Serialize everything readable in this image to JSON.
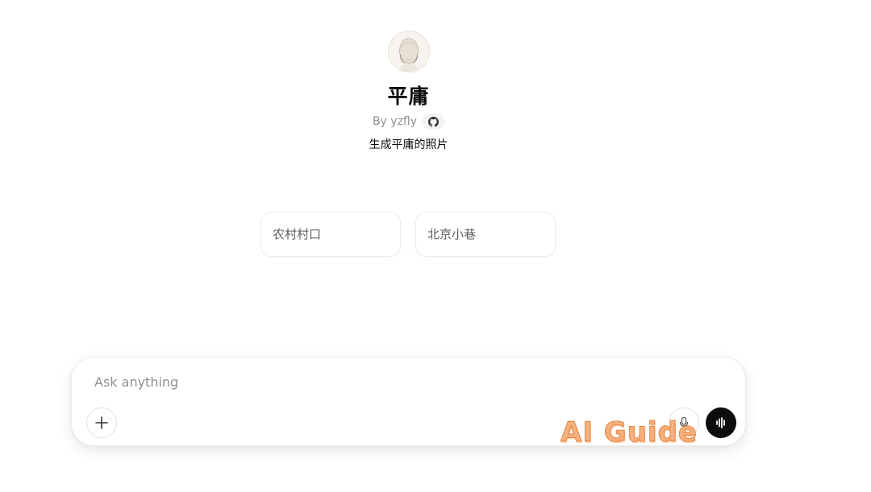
{
  "gpt": {
    "title": "平庸",
    "author": "By yzfly",
    "description": "生成平庸的照片",
    "avatar_icon": "mannequin-face-icon",
    "author_link_icon": "github-icon"
  },
  "starters": [
    {
      "label": "农村村口"
    },
    {
      "label": "北京小巷"
    }
  ],
  "composer": {
    "placeholder": "Ask anything",
    "value": "",
    "attach_icon": "plus-icon",
    "mic_icon": "microphone-icon",
    "voice_icon": "voice-mode-icon"
  },
  "watermark": {
    "text": "AI Guide"
  },
  "colors": {
    "background": "#ffffff",
    "text_primary": "#0d0d0d",
    "text_secondary": "#8f8f8f",
    "watermark": "#f6b07e"
  }
}
